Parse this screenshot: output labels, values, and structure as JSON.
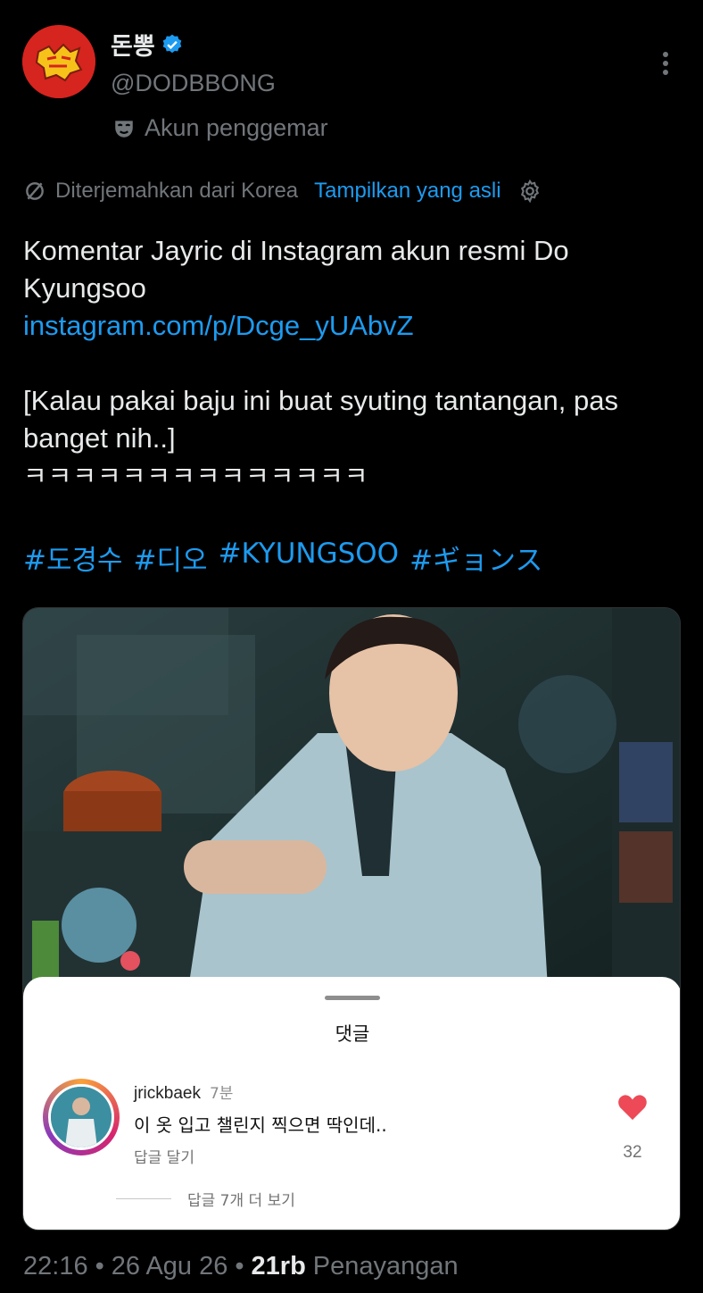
{
  "tweet": {
    "author": {
      "display_name": "돈뽕",
      "handle": "@DODBBONG",
      "verified": true,
      "label": "Akun penggemar",
      "label_icon": "mask-icon"
    },
    "translation": {
      "note": "Diterjemahkan dari Korea",
      "show_original": "Tampilkan yang asli"
    },
    "text_line1": "Komentar Jayric di Instagram akun resmi Do Kyungsoo",
    "link": "instagram.com/p/Dcge_yUAbvZ",
    "quote": "[Kalau pakai baju ini buat syuting tantangan, pas banget nih..]",
    "laugh": "ㅋㅋㅋㅋㅋㅋㅋㅋㅋㅋㅋㅋㅋㅋ",
    "hashtags": [
      "#도경수",
      "#디오",
      "#KYUNGSOO",
      "#ギョンス"
    ]
  },
  "media": {
    "sheet_title": "댓글",
    "comment": {
      "user": "jrickbaek",
      "time": "7분",
      "text": "이 옷 입고 챌린지 찍으면 딱인데..",
      "reply": "답글 달기",
      "likes": "32"
    },
    "more_replies": "답글 7개 더 보기"
  },
  "footer": {
    "time": "22:16",
    "sep": "•",
    "date": "26 Agu 26",
    "sep2": "•",
    "views": "21rb",
    "views_label": "Penayangan"
  },
  "colors": {
    "accent": "#1d9bf0",
    "muted": "#71767b",
    "text": "#e7e9ea",
    "heart": "#ed4956"
  }
}
